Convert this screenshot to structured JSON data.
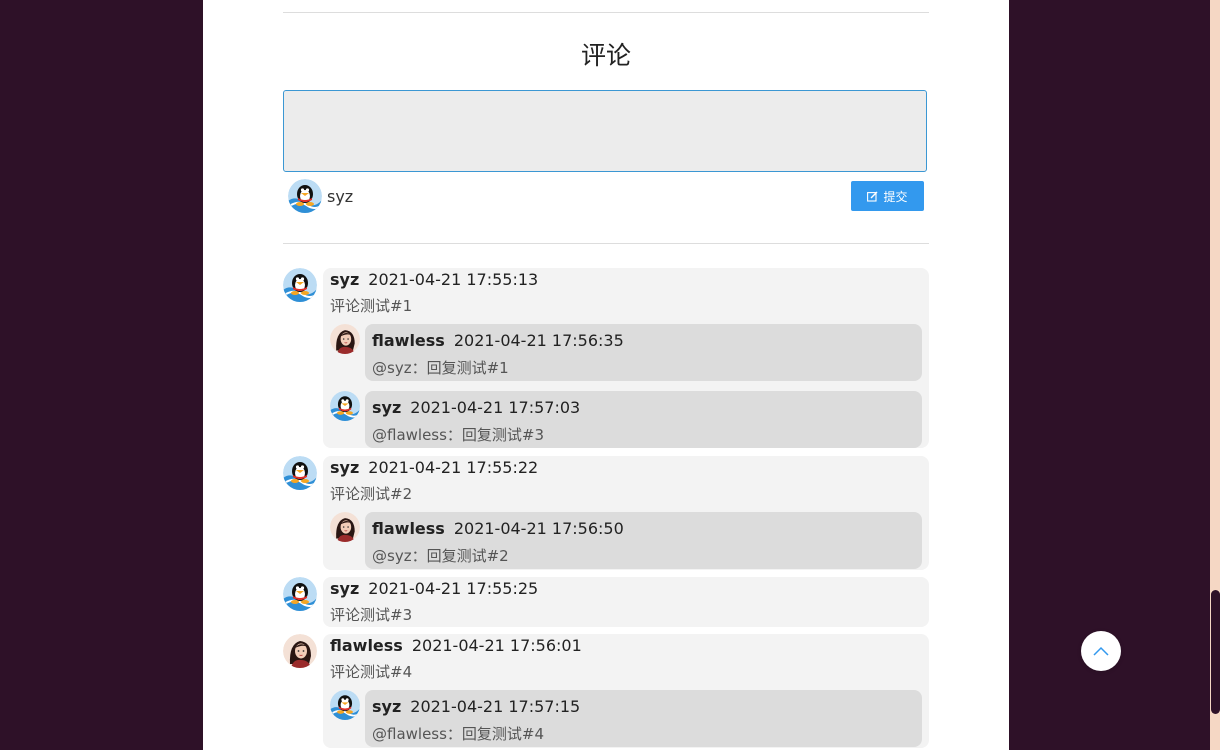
{
  "comment_section": {
    "title": "评论",
    "textarea_placeholder": "",
    "current_user": "syz",
    "submit_label": "提交",
    "submit_icon": "edit-icon"
  },
  "colors": {
    "background": "#2e1128",
    "accent": "#3399ee",
    "comment_bg": "#f3f3f3",
    "reply_bg": "#dcdcdc"
  },
  "comments": [
    {
      "author": "syz",
      "time": "2021-04-21 17:55:13",
      "text": "评论测试#1",
      "avatar": "penguin-avatar",
      "replies": [
        {
          "author": "flawless",
          "time": "2021-04-21 17:56:35",
          "text": "@syz：回复测试#1",
          "avatar": "woman-avatar"
        },
        {
          "author": "syz",
          "time": "2021-04-21 17:57:03",
          "text": "@flawless：回复测试#3",
          "avatar": "penguin-avatar"
        }
      ]
    },
    {
      "author": "syz",
      "time": "2021-04-21 17:55:22",
      "text": "评论测试#2",
      "avatar": "penguin-avatar",
      "replies": [
        {
          "author": "flawless",
          "time": "2021-04-21 17:56:50",
          "text": "@syz：回复测试#2",
          "avatar": "woman-avatar"
        }
      ]
    },
    {
      "author": "syz",
      "time": "2021-04-21 17:55:25",
      "text": "评论测试#3",
      "avatar": "penguin-avatar",
      "replies": []
    },
    {
      "author": "flawless",
      "time": "2021-04-21 17:56:01",
      "text": "评论测试#4",
      "avatar": "woman-avatar",
      "replies": [
        {
          "author": "syz",
          "time": "2021-04-21 17:57:15",
          "text": "@flawless：回复测试#4",
          "avatar": "penguin-avatar"
        }
      ]
    }
  ],
  "back_to_top_icon": "chevron-up-icon"
}
